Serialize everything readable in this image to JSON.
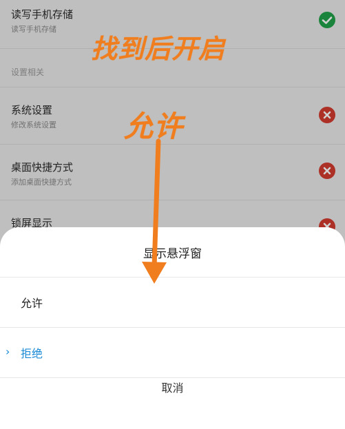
{
  "background_list": {
    "items": [
      {
        "title": "读写手机存储",
        "subtitle": "读写手机存储",
        "status": "allowed"
      },
      {
        "title": "系统设置",
        "subtitle": "修改系统设置",
        "status": "denied"
      },
      {
        "title": "桌面快捷方式",
        "subtitle": "添加桌面快捷方式",
        "status": "denied"
      },
      {
        "title": "锁屏显示",
        "subtitle": "",
        "status": "denied"
      }
    ],
    "section_header": "设置相关"
  },
  "annotations": {
    "top_hint": "找到后开启",
    "middle_hint": "允许"
  },
  "dialog": {
    "title": "显示悬浮窗",
    "options": [
      {
        "label": "允许",
        "selected": false
      },
      {
        "label": "拒绝",
        "selected": true
      }
    ],
    "cancel_label": "取消"
  },
  "colors": {
    "allowed": "#22a24a",
    "denied": "#d23b2f",
    "accent": "#1a8ad6",
    "annotation": "#f07d1e"
  }
}
